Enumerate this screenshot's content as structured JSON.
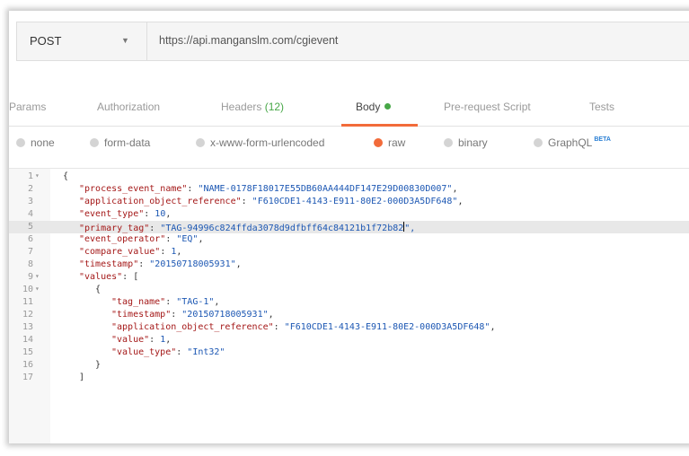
{
  "request": {
    "method": "POST",
    "url": "https://api.manganslm.com/cgievent"
  },
  "tabs": [
    {
      "label": "Params"
    },
    {
      "label": "Authorization"
    },
    {
      "label": "Headers",
      "count": "(12)"
    },
    {
      "label": "Body",
      "active": true
    },
    {
      "label": "Pre-request Script"
    },
    {
      "label": "Tests"
    }
  ],
  "body_modes": [
    {
      "label": "none"
    },
    {
      "label": "form-data"
    },
    {
      "label": "x-www-form-urlencoded"
    },
    {
      "label": "raw",
      "selected": true
    },
    {
      "label": "binary"
    },
    {
      "label": "GraphQL",
      "badge": "BETA"
    }
  ],
  "editor": {
    "highlighted_line": 5,
    "lines": [
      {
        "n": "1",
        "fold": true,
        "indent": 0,
        "text": "{"
      },
      {
        "n": "2",
        "indent": 1,
        "key": "\"process_event_name\"",
        "value": "\"NAME-0178F18017E55DB60AA444DF147E29D00830D007\"",
        "tail": ","
      },
      {
        "n": "3",
        "indent": 1,
        "key": "\"application_object_reference\"",
        "value": "\"F610CDE1-4143-E911-80E2-000D3A5DF648\"",
        "tail": ","
      },
      {
        "n": "4",
        "indent": 1,
        "key": "\"event_type\"",
        "value": "10",
        "tail": ","
      },
      {
        "n": "5",
        "indent": 1,
        "key": "\"primary_tag\"",
        "value": "\"TAG-94996c824ffda3078d9dfbff64c84121b1f72b82",
        "tail": "\","
      },
      {
        "n": "6",
        "indent": 1,
        "key": "\"event_operator\"",
        "value": "\"EQ\"",
        "tail": ","
      },
      {
        "n": "7",
        "indent": 1,
        "key": "\"compare_value\"",
        "value": "1",
        "tail": ","
      },
      {
        "n": "8",
        "indent": 1,
        "key": "\"timestamp\"",
        "value": "\"20150718005931\"",
        "tail": ","
      },
      {
        "n": "9",
        "fold": true,
        "indent": 1,
        "key": "\"values\"",
        "value": "",
        "tail": "["
      },
      {
        "n": "10",
        "fold": true,
        "indent": 2,
        "text": "{"
      },
      {
        "n": "11",
        "indent": 3,
        "key": "\"tag_name\"",
        "value": "\"TAG-1\"",
        "tail": ","
      },
      {
        "n": "12",
        "indent": 3,
        "key": "\"timestamp\"",
        "value": "\"20150718005931\"",
        "tail": ","
      },
      {
        "n": "13",
        "indent": 3,
        "key": "\"application_object_reference\"",
        "value": "\"F610CDE1-4143-E911-80E2-000D3A5DF648\"",
        "tail": ","
      },
      {
        "n": "14",
        "indent": 3,
        "key": "\"value\"",
        "value": "1",
        "tail": ","
      },
      {
        "n": "15",
        "indent": 3,
        "key": "\"value_type\"",
        "value": "\"Int32\"",
        "tail": ""
      },
      {
        "n": "16",
        "indent": 2,
        "text": "}"
      },
      {
        "n": "17",
        "indent": 1,
        "text": "]"
      }
    ]
  }
}
